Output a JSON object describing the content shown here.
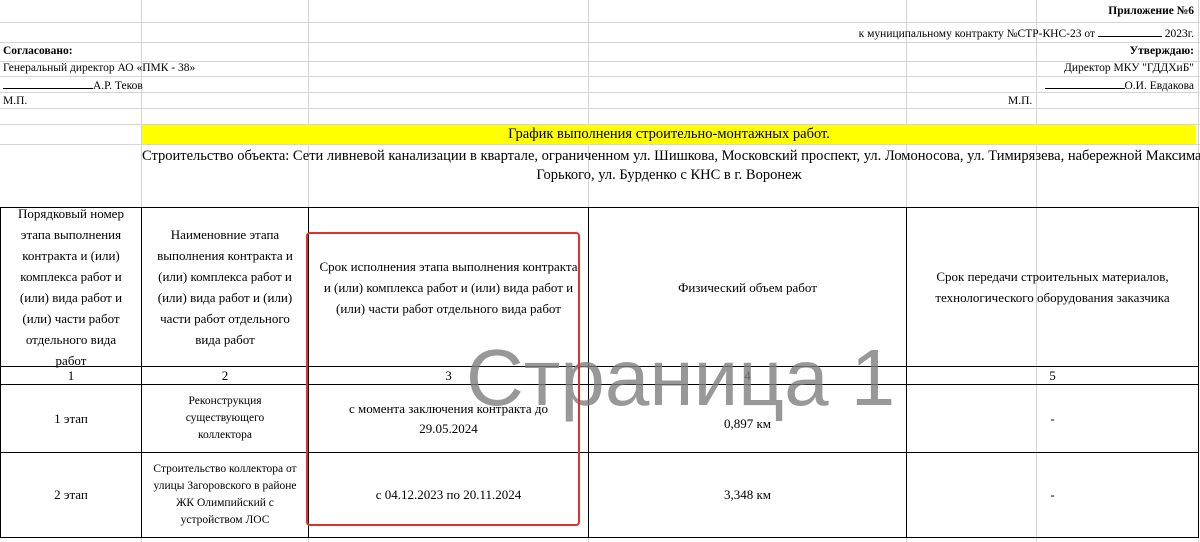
{
  "header": {
    "appendix": "Приложение №6",
    "contract_prefix": "к муниципальному контракту №СТР-КНС-23 от",
    "contract_suffix": "2023г.",
    "agreed_label": "Согласовано:",
    "agreed_position": "Генеральный директор АО «ПМК - 38»",
    "agreed_name": "А.Р. Теков",
    "stamp_left": "М.П.",
    "approve_label": "Утверждаю:",
    "approve_position": "Директор МКУ \"ГДДХиБ\"",
    "approve_name": "О.И. Евдакова",
    "stamp_right": "М.П."
  },
  "title": "График выполнения строительно-монтажных работ.",
  "object_line1": "Строительство объекта: Сети ливневой канализации в квартале, ограниченном ул. Шишкова, Московский проспект, ул. Ломоносова, ул. Тимирязева, набережной Максима",
  "object_line2": "Горького, ул. Бурденко с КНС в г. Воронеж",
  "table": {
    "headers": [
      "Порядковый номер этапа выполнения контракта и (или) комплекса работ и (или) вида работ и (или) части работ отдельного вида работ",
      "Наименовние этапа выполнения контракта и (или) комплекса работ и (или) вида работ и (или) части работ отдельного вида работ",
      "Срок исполнения этапа выполнения контракта и (или) комплекса работ и (или) вида работ и (или) части работ отдельного вида работ",
      "Физический объем работ",
      "Срок передачи строительных материалов, технологического оборудования заказчика"
    ],
    "numbers": [
      "1",
      "2",
      "3",
      "4",
      "5"
    ],
    "rows": [
      {
        "stage": "1 этап",
        "name": "Реконструкция существующего коллектора",
        "term": "с момента заключения контракта до 29.05.2024",
        "volume": "0,897 км",
        "transfer": "-"
      },
      {
        "stage": "2 этап",
        "name": "Строительство коллектора от улицы Загоровского в районе ЖК Олимпийский с устройством ЛОС",
        "term": "с 04.12.2023 по 20.11.2024",
        "volume": "3,348 км",
        "transfer": "-"
      }
    ]
  },
  "watermark": "Страница 1",
  "colors": {
    "title_bg": "#ffff00",
    "highlight_box": "#e0312e",
    "grid": "#d4d4d4",
    "watermark": "#7f7f7f"
  }
}
